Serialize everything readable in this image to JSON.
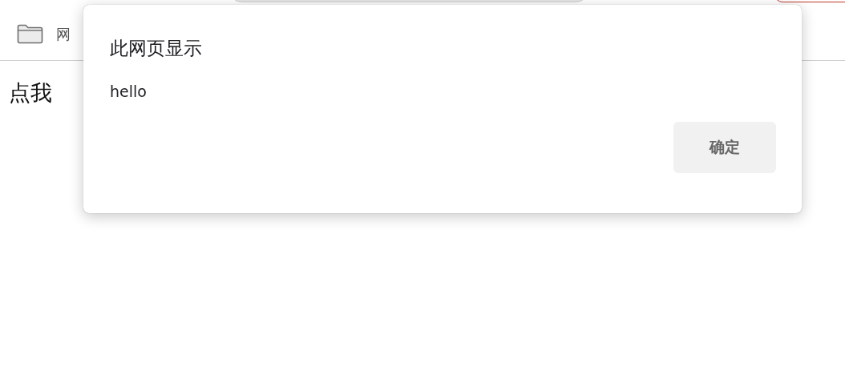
{
  "bookmarks_bar": {
    "items": [
      {
        "label": "网"
      }
    ]
  },
  "page": {
    "link_text": "点我"
  },
  "dialog": {
    "title": "此网页显示",
    "message": "hello",
    "buttons": [
      "确定"
    ]
  }
}
